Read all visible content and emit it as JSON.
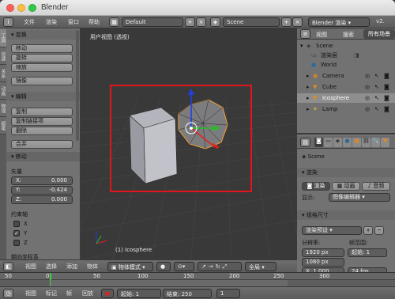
{
  "window": {
    "title": "Blender"
  },
  "info_header": {
    "menus": [
      "文件",
      "渲染",
      "窗口",
      "帮助"
    ],
    "layout": "Default",
    "scene": "Scene",
    "engine": "Blender 渲染",
    "version": "v2."
  },
  "left_tabs": [
    "工具",
    "创建",
    "关系",
    "动画",
    "物理",
    "蜡笔"
  ],
  "tool_panel": {
    "transform_title": "变换",
    "transform_buttons": [
      "移动",
      "旋转",
      "缩放"
    ],
    "mirror_button": "镜像",
    "edit_title": "编辑",
    "edit_buttons": [
      "复制",
      "复制链接项",
      "删除"
    ],
    "join_button": "合并"
  },
  "operator_panel": {
    "title": "移动",
    "vector_label": "矢量",
    "fields": [
      {
        "axis": "X:",
        "value": "0.000"
      },
      {
        "axis": "Y:",
        "value": "-0.424"
      },
      {
        "axis": "Z:",
        "value": "0.000"
      }
    ],
    "constraint_label": "约束轴",
    "checks": [
      {
        "label": "X",
        "checked": false
      },
      {
        "label": "Y",
        "checked": true
      },
      {
        "label": "Z",
        "checked": false
      }
    ],
    "orientation_label": "朝向坐标系"
  },
  "viewport": {
    "view_label": "用户视图 (透视)",
    "object_label": "(1) Icosphere"
  },
  "outliner": {
    "tabs": [
      "视图",
      "搜索",
      "所有场景"
    ],
    "items": [
      {
        "name": "Scene",
        "icon": "scene-icon",
        "indent": 0
      },
      {
        "name": "渲染层",
        "icon": "render-layer-icon",
        "indent": 1
      },
      {
        "name": "World",
        "icon": "world-icon",
        "indent": 1
      },
      {
        "name": "Camera",
        "icon": "camera-icon",
        "indent": 1
      },
      {
        "name": "Cube",
        "icon": "mesh-icon",
        "indent": 1
      },
      {
        "name": "Icosphere",
        "icon": "mesh-icon",
        "indent": 1
      },
      {
        "name": "Lamp",
        "icon": "lamp-icon",
        "indent": 1
      }
    ]
  },
  "properties": {
    "scene": "Scene",
    "render_title": "渲染",
    "render_buttons": [
      "渲染",
      "动画",
      "音频"
    ],
    "display_label": "显示:",
    "display_value": "图像编辑器",
    "dimensions_title": "规格尺寸",
    "preset": "渲染预设",
    "resolution_label": "分辨率:",
    "frame_range_label": "帧范围:",
    "res_x": "1920 px",
    "res_y": "1080 px",
    "start_label": "起始:",
    "start_value": "1",
    "x_field": "X: 1.000",
    "fps": "24 fps"
  },
  "viewport_header": {
    "menus": [
      "视图",
      "选择",
      "添加",
      "物体"
    ],
    "mode": "物体模式",
    "pivot": "全局"
  },
  "timeline": {
    "ticks": [
      "50",
      "0",
      "50",
      "100",
      "150",
      "200",
      "250",
      "300"
    ],
    "current": "1"
  },
  "timeline_header": {
    "menus": [
      "视图",
      "标记",
      "帧",
      "回放"
    ],
    "start_label": "起始:",
    "start_value": "1",
    "end_label": "结束:",
    "end_value": "250"
  },
  "colors": {
    "selection_rect": "#e0161c",
    "selected_object": "#f0a030",
    "gizmo_x": "#e02020",
    "gizmo_y": "#20c020",
    "gizmo_z": "#2040e0"
  }
}
